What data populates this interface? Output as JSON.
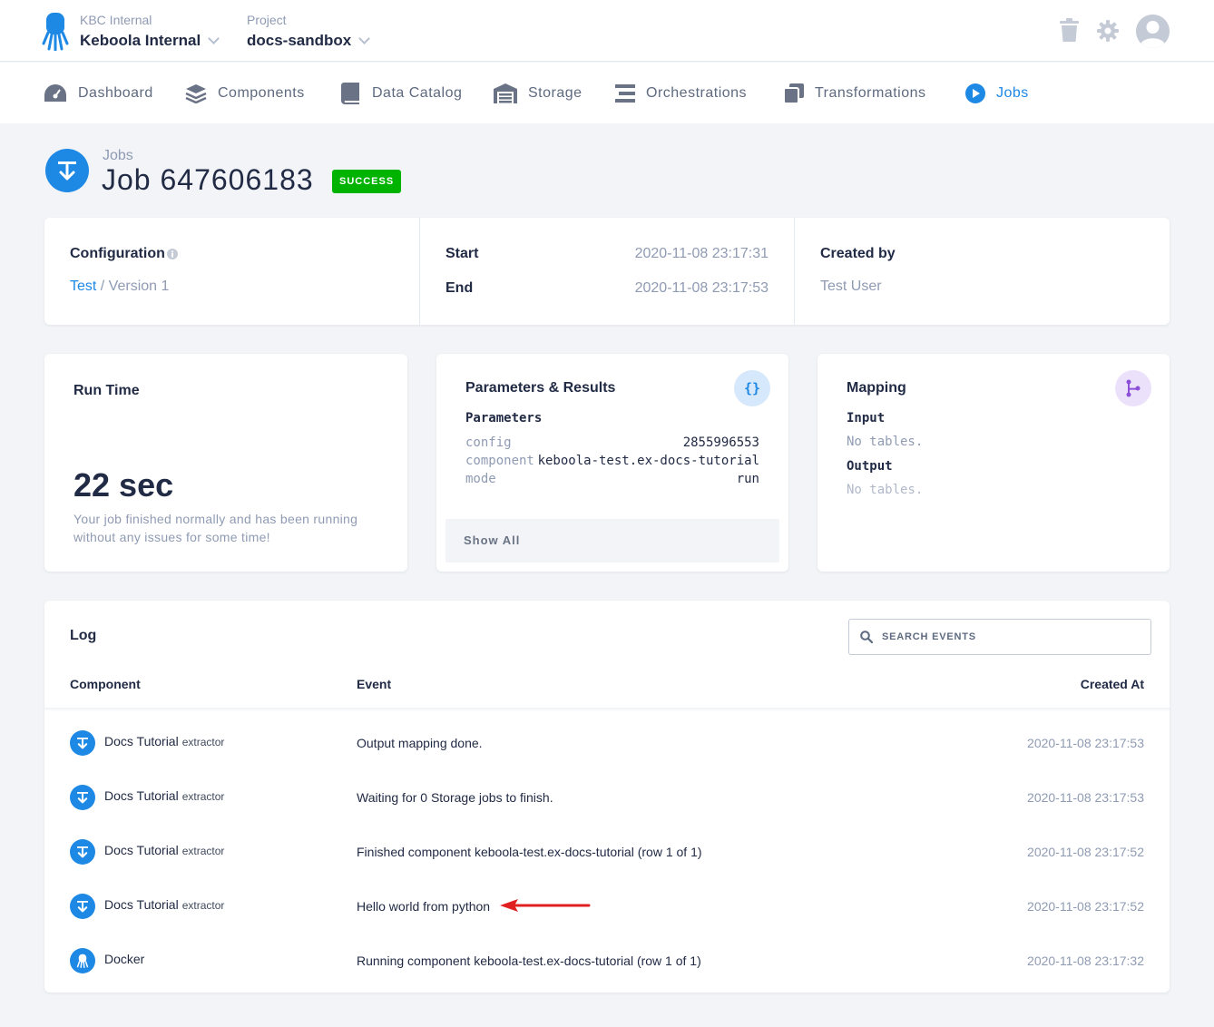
{
  "topbar": {
    "org_label": "KBC Internal",
    "org_name": "Keboola Internal",
    "project_label": "Project",
    "project_name": "docs-sandbox"
  },
  "nav": {
    "items": [
      {
        "label": "Dashboard",
        "icon": "dashboard-icon"
      },
      {
        "label": "Components",
        "icon": "layers-icon"
      },
      {
        "label": "Data Catalog",
        "icon": "book-icon"
      },
      {
        "label": "Storage",
        "icon": "warehouse-icon"
      },
      {
        "label": "Orchestrations",
        "icon": "bars-icon"
      },
      {
        "label": "Transformations",
        "icon": "copy-icon"
      },
      {
        "label": "Jobs",
        "icon": "play-circle-icon",
        "active": true
      }
    ]
  },
  "header": {
    "breadcrumb": "Jobs",
    "title": "Job 647606183",
    "status": "SUCCESS"
  },
  "info": {
    "configuration_label": "Configuration",
    "config_link": "Test",
    "config_version": " / Version 1",
    "start_label": "Start",
    "start_value": "2020-11-08 23:17:31",
    "end_label": "End",
    "end_value": "2020-11-08 23:17:53",
    "created_by_label": "Created by",
    "created_by_value": "Test User"
  },
  "runtime": {
    "title": "Run Time",
    "value": "22 sec",
    "description": "Your job finished normally and has been running without any issues for some time!"
  },
  "params": {
    "title": "Parameters & Results",
    "section": "Parameters",
    "rows": [
      {
        "key": "config",
        "value": "2855996553"
      },
      {
        "key": "component",
        "value": "keboola-test.ex-docs-tutorial"
      },
      {
        "key": "mode",
        "value": "run"
      }
    ],
    "show_all": "Show All"
  },
  "mapping": {
    "title": "Mapping",
    "input_label": "Input",
    "input_value": "No tables.",
    "output_label": "Output",
    "output_value": "No tables."
  },
  "log": {
    "title": "Log",
    "search_placeholder": "SEARCH EVENTS",
    "columns": {
      "component": "Component",
      "event": "Event",
      "created_at": "Created At"
    },
    "rows": [
      {
        "component": "Docs Tutorial",
        "type": "extractor",
        "event": "Output mapping done.",
        "created_at": "2020-11-08 23:17:53"
      },
      {
        "component": "Docs Tutorial",
        "type": "extractor",
        "event": "Waiting for 0 Storage jobs to finish.",
        "created_at": "2020-11-08 23:17:53"
      },
      {
        "component": "Docs Tutorial",
        "type": "extractor",
        "event": "Finished component keboola-test.ex-docs-tutorial (row 1 of 1)",
        "created_at": "2020-11-08 23:17:52"
      },
      {
        "component": "Docs Tutorial",
        "type": "extractor",
        "event": "Hello world from python",
        "created_at": "2020-11-08 23:17:52"
      },
      {
        "component": "Docker",
        "type": "",
        "event": "Running component keboola-test.ex-docs-tutorial (row 1 of 1)",
        "created_at": "2020-11-08 23:17:32"
      }
    ]
  },
  "colors": {
    "accent": "#1e88e5",
    "success": "#00b300",
    "annotation_arrow": "#e02020"
  }
}
